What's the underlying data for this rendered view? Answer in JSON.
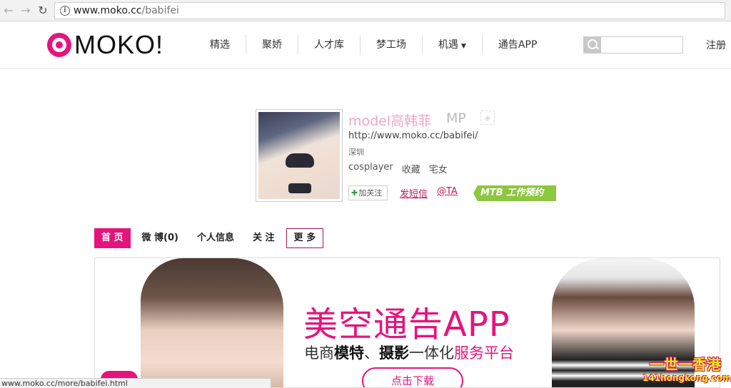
{
  "browser": {
    "url_host": "www.moko.cc",
    "url_path": "/babifei",
    "status_url": "www.moko.cc/more/babifei.html"
  },
  "header": {
    "logo_text": "MOKO!",
    "menu": [
      "精选",
      "聚娇",
      "人才库",
      "梦工场",
      "机遇",
      "通告APP"
    ],
    "menu_dropdown_caret": "▼",
    "search_placeholder": "",
    "register": "注册"
  },
  "profile": {
    "name": "model高韩菲",
    "level": "MP",
    "url": "http://www.moko.cc/babifei/",
    "city": "深圳",
    "tags": [
      "cosplayer",
      "收藏",
      "宅女"
    ],
    "follow_label": "加关注",
    "message_label": "发短信",
    "at_label": "@TA",
    "mtb_label": "MTB 工作预约"
  },
  "tabs": [
    {
      "label": "首 页",
      "active": true
    },
    {
      "label": "微 博(0)",
      "active": false
    },
    {
      "label": "个人信息",
      "active": false
    },
    {
      "label": "关 注",
      "active": false
    },
    {
      "label": "更 多",
      "active": false
    }
  ],
  "banner": {
    "title": "美空通告APP",
    "sub_1": "电商",
    "sub_2": "模特",
    "sub_3": "、",
    "sub_4": "摄影",
    "sub_5": "一体化",
    "sub_6": "服务平台",
    "button": "点击下载"
  },
  "watermark": {
    "line1": "一世一香港",
    "line2": "141hongkong.com"
  },
  "colors": {
    "brand_pink": "#e5147d",
    "mtb_green": "#8dc63f",
    "name_pink": "#f0a6c4"
  }
}
